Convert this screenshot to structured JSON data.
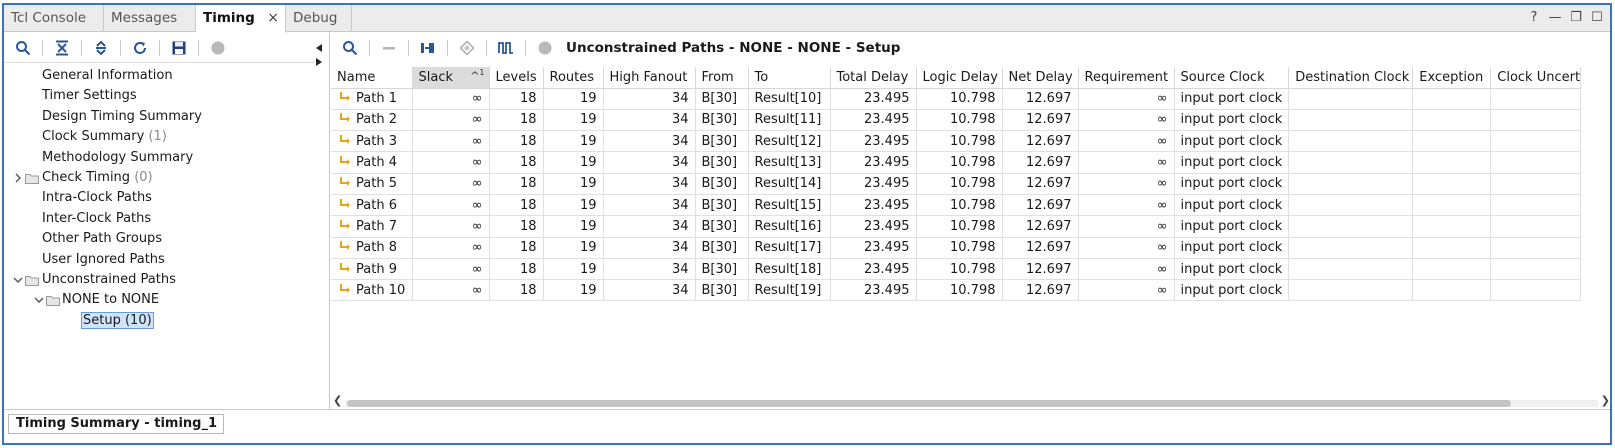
{
  "tabs": [
    {
      "label": "Tcl Console",
      "active": false
    },
    {
      "label": "Messages",
      "active": false
    },
    {
      "label": "Timing",
      "active": true,
      "close": "×"
    },
    {
      "label": "Debug",
      "active": false
    }
  ],
  "window_controls": {
    "help": "?",
    "minimize": "—",
    "restore": "❐",
    "maximize": "☐"
  },
  "left_toolbar_icons": [
    "search-icon",
    "collapse-all-icon",
    "expand-all-icon",
    "refresh-icon",
    "save-icon",
    "stop-icon"
  ],
  "tree": {
    "items": [
      {
        "label": "General Information"
      },
      {
        "label": "Timer Settings"
      },
      {
        "label": "Design Timing Summary"
      },
      {
        "label": "Clock Summary",
        "count": "(1)"
      },
      {
        "label": "Methodology Summary"
      },
      {
        "label": "Check Timing",
        "count": "(0)"
      },
      {
        "label": "Intra-Clock Paths"
      },
      {
        "label": "Inter-Clock Paths"
      },
      {
        "label": "Other Path Groups"
      },
      {
        "label": "User Ignored Paths"
      },
      {
        "label": "Unconstrained Paths"
      },
      {
        "label": "NONE to NONE"
      },
      {
        "label": "Setup (10)"
      }
    ]
  },
  "right_toolbar_icons": [
    "search-icon",
    "minus-icon",
    "schematic-icon",
    "diamond-icon",
    "waveform-icon",
    "stop-icon"
  ],
  "panel_title": "Unconstrained Paths - NONE - NONE - Setup",
  "table": {
    "columns": [
      "Name",
      "Slack",
      "Levels",
      "Routes",
      "High Fanout",
      "From",
      "To",
      "Total Delay",
      "Logic Delay",
      "Net Delay",
      "Requirement",
      "Source Clock",
      "Destination Clock",
      "Exception",
      "Clock Uncert"
    ],
    "sort": {
      "column": "Slack",
      "direction": "^",
      "priority": "1"
    },
    "rows": [
      [
        "Path 1",
        "∞",
        "18",
        "19",
        "34",
        "B[30]",
        "Result[10]",
        "23.495",
        "10.798",
        "12.697",
        "∞",
        "input port clock",
        "",
        "",
        ""
      ],
      [
        "Path 2",
        "∞",
        "18",
        "19",
        "34",
        "B[30]",
        "Result[11]",
        "23.495",
        "10.798",
        "12.697",
        "∞",
        "input port clock",
        "",
        "",
        ""
      ],
      [
        "Path 3",
        "∞",
        "18",
        "19",
        "34",
        "B[30]",
        "Result[12]",
        "23.495",
        "10.798",
        "12.697",
        "∞",
        "input port clock",
        "",
        "",
        ""
      ],
      [
        "Path 4",
        "∞",
        "18",
        "19",
        "34",
        "B[30]",
        "Result[13]",
        "23.495",
        "10.798",
        "12.697",
        "∞",
        "input port clock",
        "",
        "",
        ""
      ],
      [
        "Path 5",
        "∞",
        "18",
        "19",
        "34",
        "B[30]",
        "Result[14]",
        "23.495",
        "10.798",
        "12.697",
        "∞",
        "input port clock",
        "",
        "",
        ""
      ],
      [
        "Path 6",
        "∞",
        "18",
        "19",
        "34",
        "B[30]",
        "Result[15]",
        "23.495",
        "10.798",
        "12.697",
        "∞",
        "input port clock",
        "",
        "",
        ""
      ],
      [
        "Path 7",
        "∞",
        "18",
        "19",
        "34",
        "B[30]",
        "Result[16]",
        "23.495",
        "10.798",
        "12.697",
        "∞",
        "input port clock",
        "",
        "",
        ""
      ],
      [
        "Path 8",
        "∞",
        "18",
        "19",
        "34",
        "B[30]",
        "Result[17]",
        "23.495",
        "10.798",
        "12.697",
        "∞",
        "input port clock",
        "",
        "",
        ""
      ],
      [
        "Path 9",
        "∞",
        "18",
        "19",
        "34",
        "B[30]",
        "Result[18]",
        "23.495",
        "10.798",
        "12.697",
        "∞",
        "input port clock",
        "",
        "",
        ""
      ],
      [
        "Path 10",
        "∞",
        "18",
        "19",
        "34",
        "B[30]",
        "Result[19]",
        "23.495",
        "10.798",
        "12.697",
        "∞",
        "input port clock",
        "",
        "",
        ""
      ]
    ]
  },
  "bottom_tab": {
    "label": "Timing Summary - timing_1"
  },
  "colors": {
    "frame_border": "#3d6fc2",
    "selection_bg": "#cfe3fb",
    "path_icon": "#e8a317",
    "icon_blue": "#2b5797"
  }
}
